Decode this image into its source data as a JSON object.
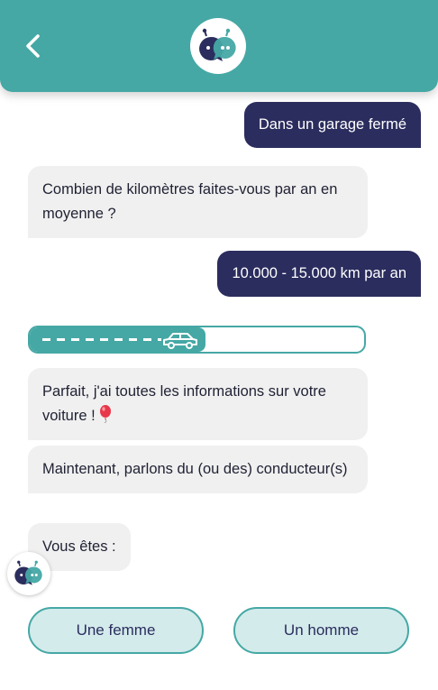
{
  "header": {
    "back_icon": "chevron-left-icon",
    "logo_icon": "chatbot-logo-icon"
  },
  "colors": {
    "header_bg": "#45a8a5",
    "user_bubble": "#2b2d5e",
    "bot_bubble": "#f0f0f0",
    "choice_bg": "#d3ebeb"
  },
  "conversation": {
    "user_message_1": "Dans un garage fermé",
    "bot_question_km": "Combien de kilomètres faites-vous par an en moyenne ?",
    "user_message_2": "10.000 - 15.000 km par an",
    "bot_message_done": "Parfait, j'ai toutes les informations sur votre voiture !",
    "balloon_icon": "balloon-icon",
    "bot_message_drivers": "Maintenant, parlons du (ou des) conducteur(s)",
    "bot_message_you_are": "Vous êtes :"
  },
  "progress": {
    "fraction": 0.525,
    "icon": "car-icon"
  },
  "choices": {
    "female_label": "Une femme",
    "male_label": "Un homme"
  }
}
